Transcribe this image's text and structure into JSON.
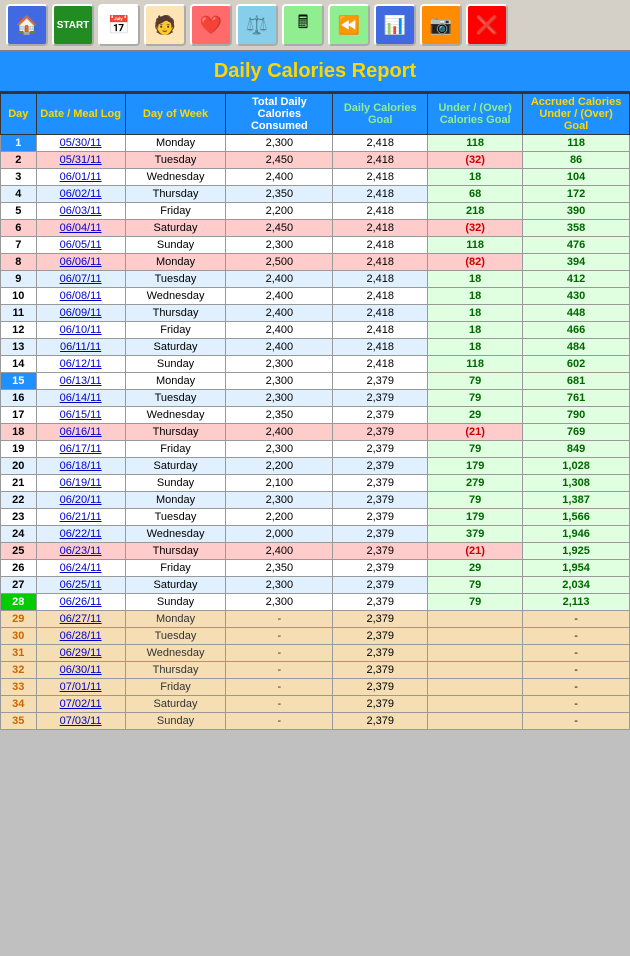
{
  "toolbar": {
    "buttons": [
      {
        "label": "🏠",
        "name": "home",
        "class": "home"
      },
      {
        "label": "START",
        "name": "start",
        "class": "start"
      },
      {
        "label": "📅",
        "name": "calendar",
        "class": "cal"
      },
      {
        "label": "🧑",
        "name": "person",
        "class": "person"
      },
      {
        "label": "❤️",
        "name": "heart",
        "class": "heart"
      },
      {
        "label": "⚖️",
        "name": "scale",
        "class": "scale"
      },
      {
        "label": "🖩",
        "name": "calculator",
        "class": "calc"
      },
      {
        "label": "⏪",
        "name": "back",
        "class": "back"
      },
      {
        "label": "📊",
        "name": "chart",
        "class": "chart"
      },
      {
        "label": "📷",
        "name": "camera",
        "class": "camera"
      },
      {
        "label": "❌",
        "name": "close",
        "class": "close"
      }
    ]
  },
  "report": {
    "title": "Daily Calories Report",
    "headers": {
      "day": "Day",
      "date": "Date / Meal Log",
      "dow": "Day of Week",
      "consumed": "Total Daily Calories Consumed",
      "goal": "Daily Calories Goal",
      "under_over": "Under / (Over) Calories Goal",
      "accrued": "Accrued Calories Under / (Over) Goal"
    },
    "rows": [
      {
        "day": 1,
        "date": "05/30/11",
        "dow": "Monday",
        "consumed": "2,300",
        "goal": "2,418",
        "under": "118",
        "accrued": "118",
        "row_class": "row-white",
        "day_class": "blue-day",
        "under_type": "under",
        "accrued_type": "accrued"
      },
      {
        "day": 2,
        "date": "05/31/11",
        "dow": "Tuesday",
        "consumed": "2,450",
        "goal": "2,418",
        "under": "(32)",
        "accrued": "86",
        "row_class": "row-pink",
        "day_class": "",
        "under_type": "over",
        "accrued_type": "accrued"
      },
      {
        "day": 3,
        "date": "06/01/11",
        "dow": "Wednesday",
        "consumed": "2,400",
        "goal": "2,418",
        "under": "18",
        "accrued": "104",
        "row_class": "row-white",
        "day_class": "",
        "under_type": "under",
        "accrued_type": "accrued"
      },
      {
        "day": 4,
        "date": "06/02/11",
        "dow": "Thursday",
        "consumed": "2,350",
        "goal": "2,418",
        "under": "68",
        "accrued": "172",
        "row_class": "row-light-blue",
        "day_class": "",
        "under_type": "under",
        "accrued_type": "accrued"
      },
      {
        "day": 5,
        "date": "06/03/11",
        "dow": "Friday",
        "consumed": "2,200",
        "goal": "2,418",
        "under": "218",
        "accrued": "390",
        "row_class": "row-white",
        "day_class": "",
        "under_type": "under",
        "accrued_type": "accrued"
      },
      {
        "day": 6,
        "date": "06/04/11",
        "dow": "Saturday",
        "consumed": "2,450",
        "goal": "2,418",
        "under": "(32)",
        "accrued": "358",
        "row_class": "row-pink",
        "day_class": "",
        "under_type": "over",
        "accrued_type": "accrued"
      },
      {
        "day": 7,
        "date": "06/05/11",
        "dow": "Sunday",
        "consumed": "2,300",
        "goal": "2,418",
        "under": "118",
        "accrued": "476",
        "row_class": "row-white",
        "day_class": "",
        "under_type": "under",
        "accrued_type": "accrued"
      },
      {
        "day": 8,
        "date": "06/06/11",
        "dow": "Monday",
        "consumed": "2,500",
        "goal": "2,418",
        "under": "(82)",
        "accrued": "394",
        "row_class": "row-pink",
        "day_class": "",
        "under_type": "over",
        "accrued_type": "accrued"
      },
      {
        "day": 9,
        "date": "06/07/11",
        "dow": "Tuesday",
        "consumed": "2,400",
        "goal": "2,418",
        "under": "18",
        "accrued": "412",
        "row_class": "row-light-blue",
        "day_class": "",
        "under_type": "under",
        "accrued_type": "accrued"
      },
      {
        "day": 10,
        "date": "06/08/11",
        "dow": "Wednesday",
        "consumed": "2,400",
        "goal": "2,418",
        "under": "18",
        "accrued": "430",
        "row_class": "row-white",
        "day_class": "",
        "under_type": "under",
        "accrued_type": "accrued"
      },
      {
        "day": 11,
        "date": "06/09/11",
        "dow": "Thursday",
        "consumed": "2,400",
        "goal": "2,418",
        "under": "18",
        "accrued": "448",
        "row_class": "row-light-blue",
        "day_class": "",
        "under_type": "under",
        "accrued_type": "accrued"
      },
      {
        "day": 12,
        "date": "06/10/11",
        "dow": "Friday",
        "consumed": "2,400",
        "goal": "2,418",
        "under": "18",
        "accrued": "466",
        "row_class": "row-white",
        "day_class": "",
        "under_type": "under",
        "accrued_type": "accrued"
      },
      {
        "day": 13,
        "date": "06/11/11",
        "dow": "Saturday",
        "consumed": "2,400",
        "goal": "2,418",
        "under": "18",
        "accrued": "484",
        "row_class": "row-light-blue",
        "day_class": "",
        "under_type": "under",
        "accrued_type": "accrued"
      },
      {
        "day": 14,
        "date": "06/12/11",
        "dow": "Sunday",
        "consumed": "2,300",
        "goal": "2,418",
        "under": "118",
        "accrued": "602",
        "row_class": "row-white",
        "day_class": "",
        "under_type": "under",
        "accrued_type": "accrued"
      },
      {
        "day": 15,
        "date": "06/13/11",
        "dow": "Monday",
        "consumed": "2,300",
        "goal": "2,379",
        "under": "79",
        "accrued": "681",
        "row_class": "row-white",
        "day_class": "blue-day",
        "under_type": "under",
        "accrued_type": "accrued"
      },
      {
        "day": 16,
        "date": "06/14/11",
        "dow": "Tuesday",
        "consumed": "2,300",
        "goal": "2,379",
        "under": "79",
        "accrued": "761",
        "row_class": "row-light-blue",
        "day_class": "",
        "under_type": "under",
        "accrued_type": "accrued"
      },
      {
        "day": 17,
        "date": "06/15/11",
        "dow": "Wednesday",
        "consumed": "2,350",
        "goal": "2,379",
        "under": "29",
        "accrued": "790",
        "row_class": "row-white",
        "day_class": "",
        "under_type": "under",
        "accrued_type": "accrued"
      },
      {
        "day": 18,
        "date": "06/16/11",
        "dow": "Thursday",
        "consumed": "2,400",
        "goal": "2,379",
        "under": "(21)",
        "accrued": "769",
        "row_class": "row-pink",
        "day_class": "",
        "under_type": "over",
        "accrued_type": "accrued"
      },
      {
        "day": 19,
        "date": "06/17/11",
        "dow": "Friday",
        "consumed": "2,300",
        "goal": "2,379",
        "under": "79",
        "accrued": "849",
        "row_class": "row-white",
        "day_class": "",
        "under_type": "under",
        "accrued_type": "accrued"
      },
      {
        "day": 20,
        "date": "06/18/11",
        "dow": "Saturday",
        "consumed": "2,200",
        "goal": "2,379",
        "under": "179",
        "accrued": "1,028",
        "row_class": "row-light-blue",
        "day_class": "",
        "under_type": "under",
        "accrued_type": "accrued"
      },
      {
        "day": 21,
        "date": "06/19/11",
        "dow": "Sunday",
        "consumed": "2,100",
        "goal": "2,379",
        "under": "279",
        "accrued": "1,308",
        "row_class": "row-white",
        "day_class": "",
        "under_type": "under",
        "accrued_type": "accrued"
      },
      {
        "day": 22,
        "date": "06/20/11",
        "dow": "Monday",
        "consumed": "2,300",
        "goal": "2,379",
        "under": "79",
        "accrued": "1,387",
        "row_class": "row-light-blue",
        "day_class": "",
        "under_type": "under",
        "accrued_type": "accrued"
      },
      {
        "day": 23,
        "date": "06/21/11",
        "dow": "Tuesday",
        "consumed": "2,200",
        "goal": "2,379",
        "under": "179",
        "accrued": "1,566",
        "row_class": "row-white",
        "day_class": "",
        "under_type": "under",
        "accrued_type": "accrued"
      },
      {
        "day": 24,
        "date": "06/22/11",
        "dow": "Wednesday",
        "consumed": "2,000",
        "goal": "2,379",
        "under": "379",
        "accrued": "1,946",
        "row_class": "row-light-blue",
        "day_class": "",
        "under_type": "under",
        "accrued_type": "accrued"
      },
      {
        "day": 25,
        "date": "06/23/11",
        "dow": "Thursday",
        "consumed": "2,400",
        "goal": "2,379",
        "under": "(21)",
        "accrued": "1,925",
        "row_class": "row-pink",
        "day_class": "",
        "under_type": "over",
        "accrued_type": "accrued"
      },
      {
        "day": 26,
        "date": "06/24/11",
        "dow": "Friday",
        "consumed": "2,350",
        "goal": "2,379",
        "under": "29",
        "accrued": "1,954",
        "row_class": "row-white",
        "day_class": "",
        "under_type": "under",
        "accrued_type": "accrued"
      },
      {
        "day": 27,
        "date": "06/25/11",
        "dow": "Saturday",
        "consumed": "2,300",
        "goal": "2,379",
        "under": "79",
        "accrued": "2,034",
        "row_class": "row-light-blue",
        "day_class": "",
        "under_type": "under",
        "accrued_type": "accrued"
      },
      {
        "day": 28,
        "date": "06/26/11",
        "dow": "Sunday",
        "consumed": "2,300",
        "goal": "2,379",
        "under": "79",
        "accrued": "2,113",
        "row_class": "row-white",
        "day_class": "green-today",
        "under_type": "under",
        "accrued_type": "accrued"
      },
      {
        "day": 29,
        "date": "06/27/11",
        "dow": "Monday",
        "consumed": "-",
        "goal": "2,379",
        "under": "",
        "accrued": "-",
        "row_class": "row-tan",
        "day_class": "",
        "under_type": "",
        "accrued_type": "future",
        "future": true
      },
      {
        "day": 30,
        "date": "06/28/11",
        "dow": "Tuesday",
        "consumed": "-",
        "goal": "2,379",
        "under": "",
        "accrued": "-",
        "row_class": "row-tan",
        "day_class": "",
        "under_type": "",
        "accrued_type": "future",
        "future": true
      },
      {
        "day": 31,
        "date": "06/29/11",
        "dow": "Wednesday",
        "consumed": "-",
        "goal": "2,379",
        "under": "",
        "accrued": "-",
        "row_class": "row-tan",
        "day_class": "",
        "under_type": "",
        "accrued_type": "future",
        "future": true
      },
      {
        "day": 32,
        "date": "06/30/11",
        "dow": "Thursday",
        "consumed": "-",
        "goal": "2,379",
        "under": "",
        "accrued": "-",
        "row_class": "row-tan",
        "day_class": "",
        "under_type": "",
        "accrued_type": "future",
        "future": true
      },
      {
        "day": 33,
        "date": "07/01/11",
        "dow": "Friday",
        "consumed": "-",
        "goal": "2,379",
        "under": "",
        "accrued": "-",
        "row_class": "row-tan",
        "day_class": "",
        "under_type": "",
        "accrued_type": "future",
        "future": true
      },
      {
        "day": 34,
        "date": "07/02/11",
        "dow": "Saturday",
        "consumed": "-",
        "goal": "2,379",
        "under": "",
        "accrued": "-",
        "row_class": "row-tan",
        "day_class": "",
        "under_type": "",
        "accrued_type": "future",
        "future": true
      },
      {
        "day": 35,
        "date": "07/03/11",
        "dow": "Sunday",
        "consumed": "-",
        "goal": "2,379",
        "under": "",
        "accrued": "-",
        "row_class": "row-tan",
        "day_class": "",
        "under_type": "",
        "accrued_type": "future",
        "future": true
      }
    ]
  }
}
